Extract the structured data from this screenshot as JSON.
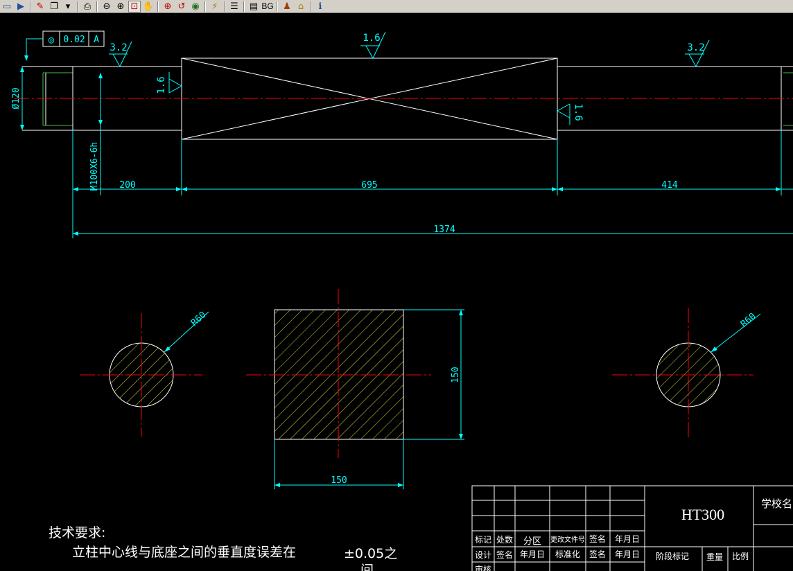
{
  "toolbar": {
    "buttons": [
      {
        "name": "save-icon",
        "glyph": "▭",
        "color": "#1f4fa0"
      },
      {
        "name": "export-icon",
        "glyph": "▶",
        "color": "#1f4fa0"
      },
      {
        "sep": true
      },
      {
        "name": "pen-icon",
        "glyph": "✎",
        "color": "#c00000"
      },
      {
        "name": "copy-icon",
        "glyph": "❐",
        "color": "#000000"
      },
      {
        "name": "dropdown-arrow-icon",
        "glyph": "▾",
        "color": "#000000"
      },
      {
        "sep": true
      },
      {
        "name": "print-icon",
        "glyph": "⎙",
        "color": "#000000"
      },
      {
        "sep": true
      },
      {
        "name": "zoom-out-icon",
        "glyph": "⊖",
        "color": "#000000"
      },
      {
        "name": "zoom-in-icon",
        "glyph": "⊕",
        "color": "#000000"
      },
      {
        "name": "zoom-window-icon",
        "glyph": "⊡",
        "color": "#c00000",
        "on": true
      },
      {
        "name": "pan-hand-icon",
        "glyph": "✋",
        "color": "#000000"
      },
      {
        "sep": true
      },
      {
        "name": "zoom-all-icon",
        "glyph": "⊕",
        "color": "#c00000"
      },
      {
        "name": "zoom-previous-icon",
        "glyph": "↺",
        "color": "#c00000"
      },
      {
        "name": "view-eye-icon",
        "glyph": "◉",
        "color": "#207020"
      },
      {
        "sep": true
      },
      {
        "name": "measure-icon",
        "glyph": "⚡",
        "color": "#a08000"
      },
      {
        "sep": true
      },
      {
        "name": "layers-icon",
        "glyph": "☰",
        "color": "#000000"
      },
      {
        "sep": true
      },
      {
        "name": "properties-icon",
        "glyph": "▤",
        "color": "#000000"
      },
      {
        "name": "background-button",
        "glyph": "BG",
        "color": "#000000",
        "text": true
      },
      {
        "sep": true
      },
      {
        "name": "user-settings-icon",
        "glyph": "♟",
        "color": "#a04000"
      },
      {
        "name": "home-icon",
        "glyph": "⌂",
        "color": "#b08000"
      },
      {
        "sep": true
      },
      {
        "name": "info-icon",
        "glyph": "ℹ",
        "color": "#1f4fa0"
      }
    ]
  },
  "drawing": {
    "colors": {
      "geometry": "#ffffff",
      "dimension": "#00ffff",
      "centerline": "#ff0000",
      "hatch": "#e0e040",
      "border": "#ffffff",
      "background": "#000000"
    },
    "tolerance_frame": {
      "symbol": "◎",
      "value": "0.02",
      "datum": "A"
    },
    "roughness": {
      "left": "3.2",
      "top": "1.6",
      "left_shoulder": "1.6",
      "right_shoulder": "1.6",
      "right": "3.2"
    },
    "dims": {
      "diameter": "Ø120",
      "thread": "M100X6-6h",
      "len_left": "200",
      "len_mid": "695",
      "len_right": "414",
      "len_total": "1374",
      "radius_left": "R60",
      "radius_right": "R60",
      "square_h": "150",
      "square_w": "150"
    },
    "notes": {
      "heading": "技术要求:",
      "line1": "立柱中心线与底座之间的垂直度误差在",
      "line1_tol": "±0.05之",
      "line1_cont": "间"
    },
    "title_block": {
      "material": "HT300",
      "school": "学校名",
      "revision_headers": [
        "标记",
        "处数",
        "分区",
        "更改文件号",
        "签名",
        "年月日"
      ],
      "sign_row": [
        "设计",
        "签名",
        "年月日",
        "标准化",
        "签名",
        "年月日"
      ],
      "stage": "阶段标记",
      "weight": "重量",
      "scale": "比例",
      "reviewer": "审核"
    }
  }
}
